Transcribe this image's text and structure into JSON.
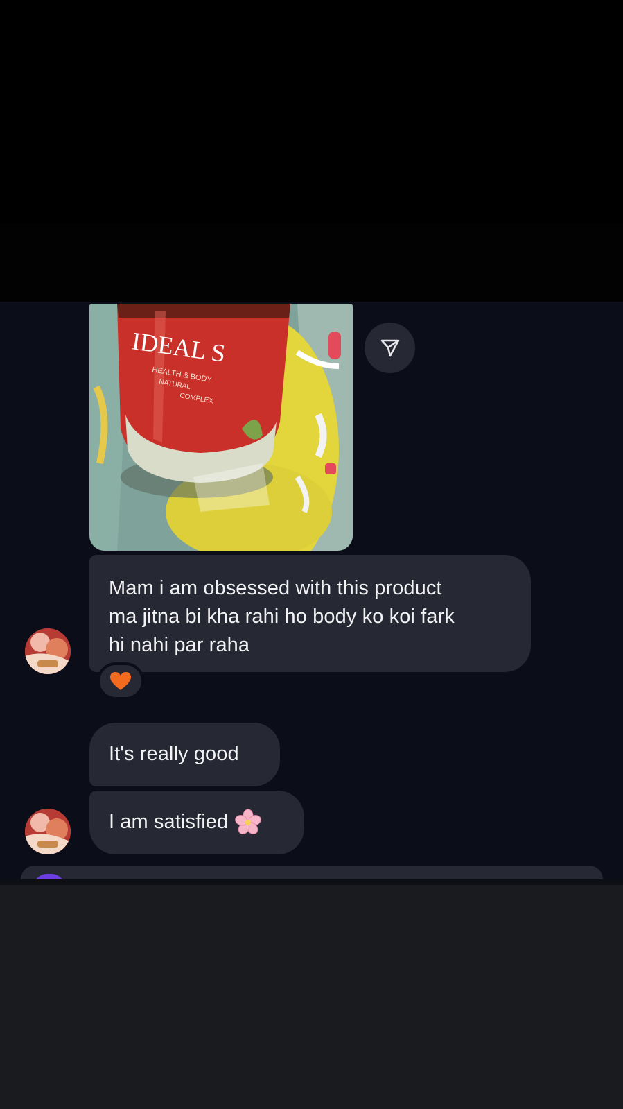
{
  "messages": [
    {
      "type": "image",
      "sender": "other",
      "image_text": "IDEAL S"
    },
    {
      "type": "text",
      "sender": "other",
      "lines": [
        "Mam i am obsessed with this product",
        "ma jitna bi kha rahi ho body ko koi fark",
        "hi nahi par raha"
      ],
      "reaction": "orange-heart"
    },
    {
      "type": "text",
      "sender": "other",
      "text": "It's really good"
    },
    {
      "type": "text",
      "sender": "other",
      "text": "I am satisfied",
      "emoji": "cherry-blossom"
    }
  ],
  "icons": {
    "share": "send-icon",
    "reaction": "orange-heart-icon",
    "emoji": "cherry-blossom-icon"
  },
  "colors": {
    "chat_background": "#0b0d18",
    "bubble": "#262933",
    "text": "#f2f2f4",
    "heart": "#f46a1f"
  }
}
